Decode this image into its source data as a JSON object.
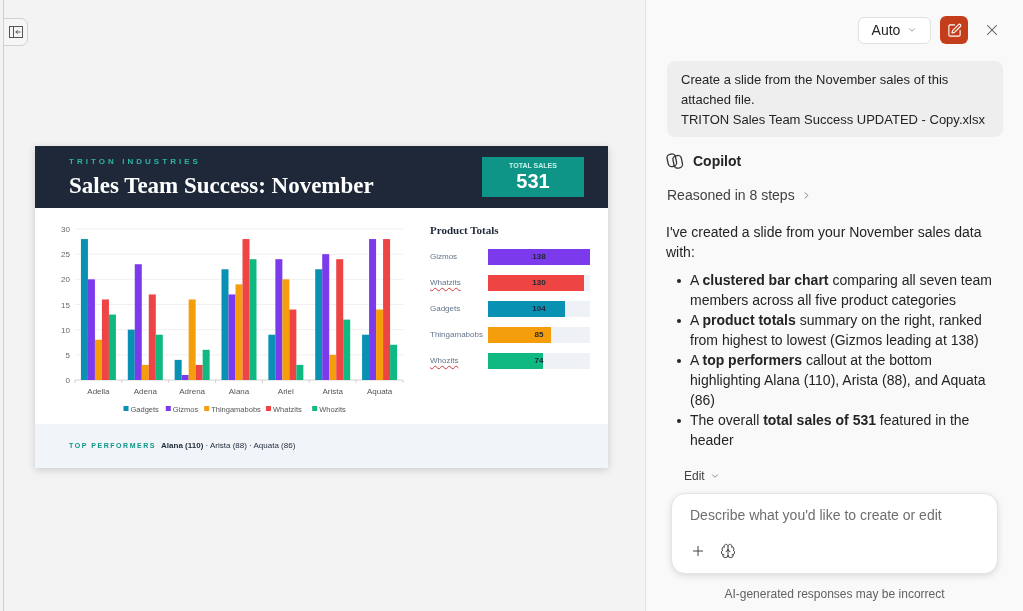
{
  "slide": {
    "header": {
      "company": "TRITON INDUSTRIES",
      "title": "Sales Team Success: November",
      "total_sales": {
        "label": "TOTAL SALES",
        "value": "531"
      }
    },
    "chart_data": {
      "type": "bar",
      "categories": [
        "Adella",
        "Adena",
        "Adrena",
        "Alana",
        "Ariel",
        "Arista",
        "Aquata"
      ],
      "series": [
        {
          "name": "Gadgets",
          "color": "#0891b2",
          "values": [
            28,
            10,
            4,
            22,
            9,
            22,
            9
          ]
        },
        {
          "name": "Gizmos",
          "color": "#7c3aed",
          "values": [
            20,
            23,
            1,
            17,
            24,
            25,
            28
          ]
        },
        {
          "name": "Thingamabobs",
          "color": "#f59e0b",
          "values": [
            8,
            3,
            16,
            19,
            20,
            5,
            14
          ]
        },
        {
          "name": "Whatzits",
          "color": "#ef4444",
          "values": [
            16,
            17,
            3,
            28,
            14,
            24,
            28
          ]
        },
        {
          "name": "Whozits",
          "color": "#10b981",
          "values": [
            13,
            9,
            6,
            24,
            3,
            12,
            7
          ]
        }
      ],
      "ylim": [
        0,
        30
      ],
      "yticks": [
        0,
        5,
        10,
        15,
        20,
        25,
        30
      ],
      "grid": true,
      "legend": "bottom"
    },
    "product_totals": {
      "title": "Product Totals",
      "items": [
        {
          "label": "Gizmos",
          "value": "138",
          "level": 1,
          "color": "#7c3aed",
          "misspelled": false
        },
        {
          "label": "Whatzits",
          "value": "130",
          "level": 0.94,
          "color": "#ef4444",
          "misspelled": true
        },
        {
          "label": "Gadgets",
          "value": "104",
          "level": 0.754,
          "color": "#0891b2",
          "misspelled": false
        },
        {
          "label": "Thingamabobs",
          "value": "85",
          "level": 0.616,
          "color": "#f59e0b",
          "misspelled": false
        },
        {
          "label": "Whozits",
          "value": "74",
          "level": 0.536,
          "color": "#10b981",
          "misspelled": true
        }
      ]
    },
    "footer": {
      "label": "TOP PERFORMERS",
      "text": "**Alana (110)** · Arista (88) · Aquata (86)"
    }
  },
  "copilot_panel": {
    "mode_dropdown": {
      "value": "Auto"
    },
    "user_message": {
      "text": "Create a slide from the November sales of this attached file.",
      "attachment": "TRITON Sales Team Success UPDATED - Copy.xlsx"
    },
    "assistant": {
      "name": "Copilot",
      "reasoning": "Reasoned in 8 steps",
      "intro": "I've created a slide from your November sales data with:",
      "bullets": [
        "A **clustered bar chart** comparing all seven team members across all five product categories",
        "A **product totals** summary on the right, ranked from highest to lowest (Gizmos leading at 138)",
        "A **top performers** callout at the bottom highlighting Alana (110), Arista (88), and Aquata (86)",
        "The overall **total sales of 531** featured in the header"
      ]
    },
    "edit_menu": {
      "label": "Edit"
    },
    "composer": {
      "placeholder": "Describe what you'd like to create or edit"
    },
    "disclaimer": "AI-generated responses may be incorrect"
  }
}
